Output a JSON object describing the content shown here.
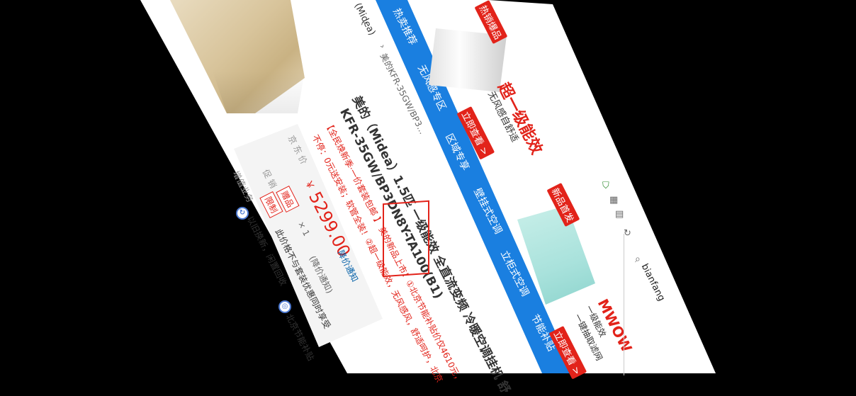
{
  "breadcrumb": {
    "category": "(Midea)",
    "model": "美的KFR-35GW/BP3..."
  },
  "nav": {
    "items": [
      "热卖推荐",
      "无风感专区",
      "区域专享",
      "壁挂式空调",
      "立柜式空调",
      "节能补贴"
    ]
  },
  "product": {
    "title_line1": "美的（Midea）1.5匹 一级能效 全直流变频 冷暖空调挂机 舒",
    "title_line2": "KFR-35GW/BP3DN8Y-TA100(B1)",
    "promo_line1": "【全民焕新季·一价套装包邮 】 美的新品上市！①北京节能补贴价仅4610元，",
    "promo_line2": "不停：0元送安装；软管全装！②超一级能效，无风感风，舒适呵护，北京"
  },
  "price": {
    "label": "京 东 价",
    "currency": "￥",
    "value": "5299.00",
    "note": "(降价通知)",
    "alert_link": "降价通知",
    "promo_label": "促 销",
    "badge_gift": "赠品",
    "badge_limit": "限制",
    "gift_qty": "× 1",
    "gift_note": "(赠完即止)",
    "limit_text": "此价格不与套装优惠同时享受"
  },
  "services": {
    "label": "增值业务",
    "item1": "以旧换新，闲置回收",
    "item2": "北京节能补贴"
  },
  "ads": {
    "ad1_badge": "热销爆品",
    "ad1_title": "超一级能效",
    "ad1_sub": "无风感自舒适",
    "ad1_btn": "立即查看 >",
    "ad2_badge": "新品首发",
    "ad2_title": "MWOW",
    "ad2_sub1": "一级能效",
    "ad2_sub2": "一键抽取滤网",
    "ad2_btn": "立即查看 >"
  },
  "search": {
    "value": "bianfang"
  },
  "colors": {
    "nav_blue": "#1a7fe0",
    "jd_red": "#e2231a",
    "link_blue": "#005ea7"
  }
}
